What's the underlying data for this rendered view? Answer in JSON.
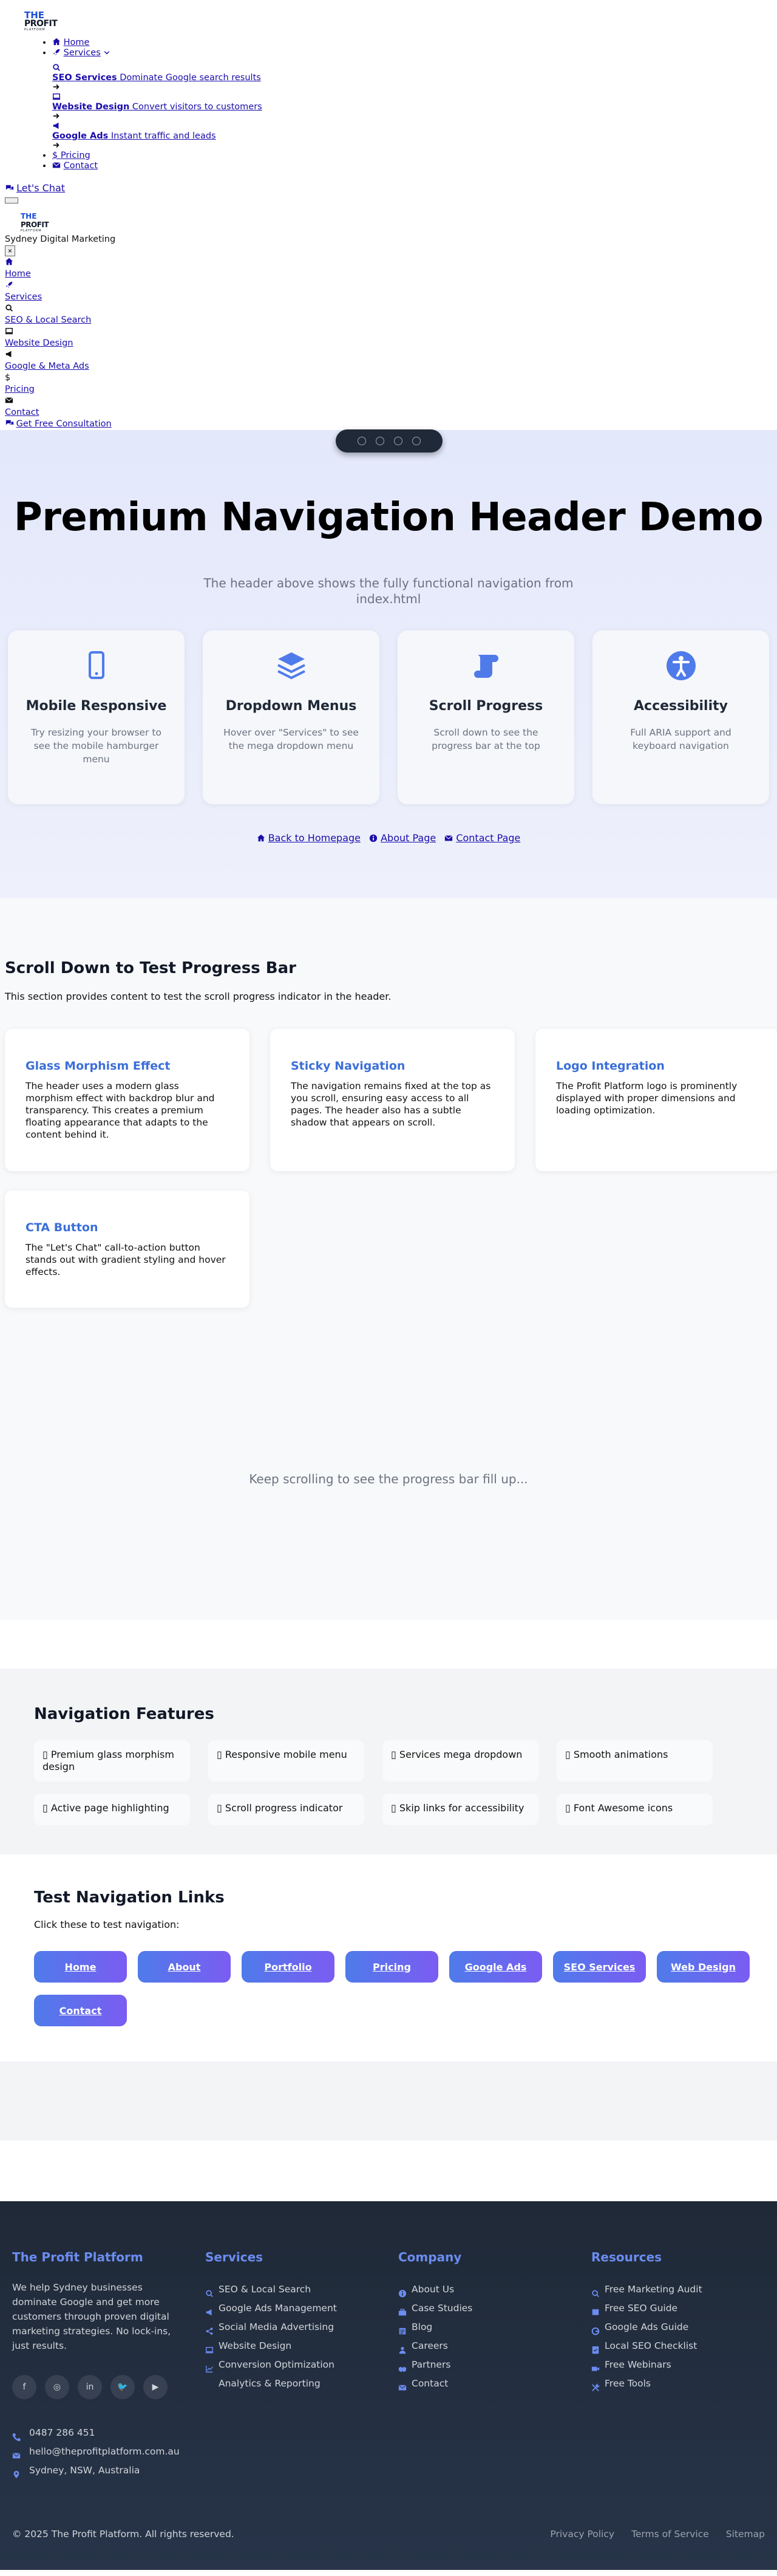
{
  "logo": {
    "line1": "THE",
    "line2": "PROFIT",
    "line3": "PLATFORM"
  },
  "nav": {
    "home": "Home",
    "services": "Services",
    "mega": [
      {
        "title": "SEO Services",
        "desc": "Dominate Google search results"
      },
      {
        "title": "Website Design",
        "desc": "Convert visitors to customers"
      },
      {
        "title": "Google Ads",
        "desc": "Instant traffic and leads"
      }
    ],
    "pricing": "Pricing",
    "contact": "Contact",
    "cta": "Let's Chat"
  },
  "mobile": {
    "tagline": "Sydney Digital Marketing",
    "close": "×",
    "home": "Home",
    "services": "Services",
    "seo": "SEO & Local Search",
    "web": "Website Design",
    "ads": "Google & Meta Ads",
    "pricing": "Pricing",
    "contact": "Contact",
    "cta": "Get Free Consultation"
  },
  "hero": {
    "title": "Premium Navigation Header Demo",
    "subtitle": "The header above shows the fully functional navigation from index.html",
    "cards": [
      {
        "icon": "mobile-icon",
        "title": "Mobile Responsive",
        "text": "Try resizing your browser to see the mobile hamburger menu"
      },
      {
        "icon": "layers-icon",
        "title": "Dropdown Menus",
        "text": "Hover over \"Services\" to see the mega dropdown menu"
      },
      {
        "icon": "scroll-icon",
        "title": "Scroll Progress",
        "text": "Scroll down to see the progress bar at the top"
      },
      {
        "icon": "accessibility-icon",
        "title": "Accessibility",
        "text": "Full ARIA support and keyboard navigation"
      }
    ],
    "links": [
      "Back to Homepage",
      "About Page",
      "Contact Page"
    ]
  },
  "progress": {
    "title": "Scroll Down to Test Progress Bar",
    "lead": "This section provides content to test the scroll progress indicator in the header.",
    "cards": [
      {
        "title": "Glass Morphism Effect",
        "text": "The header uses a modern glass morphism effect with backdrop blur and transparency. This creates a premium floating appearance that adapts to the content behind it."
      },
      {
        "title": "Sticky Navigation",
        "text": "The navigation remains fixed at the top as you scroll, ensuring easy access to all pages. The header also has a subtle shadow that appears on scroll."
      },
      {
        "title": "Logo Integration",
        "text": "The Profit Platform logo is prominently displayed with proper dimensions and loading optimization."
      },
      {
        "title": "CTA Button",
        "text": "The \"Let's Chat\" call-to-action button stands out with gradient styling and hover effects."
      }
    ],
    "keep": "Keep scrolling to see the progress bar fill up..."
  },
  "features": {
    "title": "Navigation Features",
    "items": [
      "Premium glass morphism design",
      "Responsive mobile menu",
      "Services mega dropdown",
      "Smooth animations",
      "Active page highlighting",
      "Scroll progress indicator",
      "Skip links for accessibility",
      "Font Awesome icons"
    ]
  },
  "testlinks": {
    "title": "Test Navigation Links",
    "lead": "Click these to test navigation:",
    "buttons": [
      "Home",
      "About",
      "Portfolio",
      "Pricing",
      "Google Ads",
      "SEO Services",
      "Web Design",
      "Contact"
    ]
  },
  "footer": {
    "brand": "The Profit Platform",
    "about": "We help Sydney businesses dominate Google and get more customers through proven digital marketing strategies. No lock-ins, just results.",
    "phone": "0487 286 451",
    "email": "hello@theprofitplatform.com.au",
    "location": "Sydney, NSW, Australia",
    "services_title": "Services",
    "services": [
      "SEO & Local Search",
      "Google Ads Management",
      "Social Media Advertising",
      "Website Design",
      "Conversion Optimization",
      "Analytics & Reporting"
    ],
    "company_title": "Company",
    "company": [
      "About Us",
      "Case Studies",
      "Blog",
      "Careers",
      "Partners",
      "Contact"
    ],
    "resources_title": "Resources",
    "resources": [
      "Free Marketing Audit",
      "Free SEO Guide",
      "Google Ads Guide",
      "Local SEO Checklist",
      "Free Webinars",
      "Free Tools"
    ],
    "copyright": "© 2025 The Profit Platform. All rights reserved.",
    "legal": [
      "Privacy Policy",
      "Terms of Service",
      "Sitemap"
    ]
  }
}
